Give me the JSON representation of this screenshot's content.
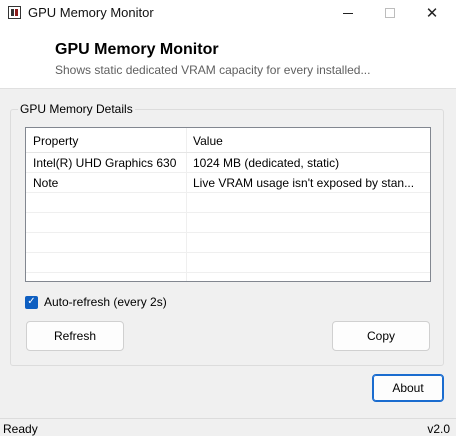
{
  "window": {
    "title": "GPU Memory Monitor",
    "minimize_glyph": "",
    "close_glyph": "✕"
  },
  "header": {
    "title": "GPU Memory Monitor",
    "subtitle": "Shows static dedicated VRAM capacity for every installed..."
  },
  "details": {
    "group_label": "GPU Memory Details",
    "columns": [
      "Property",
      "Value"
    ],
    "rows": [
      {
        "property": "Intel(R) UHD Graphics 630",
        "value": "1024 MB (dedicated, static)"
      },
      {
        "property": "Note",
        "value": "Live VRAM usage isn't exposed by stan..."
      }
    ]
  },
  "auto_refresh": {
    "label": "Auto-refresh (every 2s)",
    "checked": true,
    "check_glyph": "✓"
  },
  "buttons": {
    "refresh": "Refresh",
    "copy": "Copy",
    "about": "About"
  },
  "status": {
    "text": "Ready",
    "version": "v2.0"
  },
  "colors": {
    "accent": "#0f5fc1",
    "default_button_border": "#1a6ccf"
  }
}
